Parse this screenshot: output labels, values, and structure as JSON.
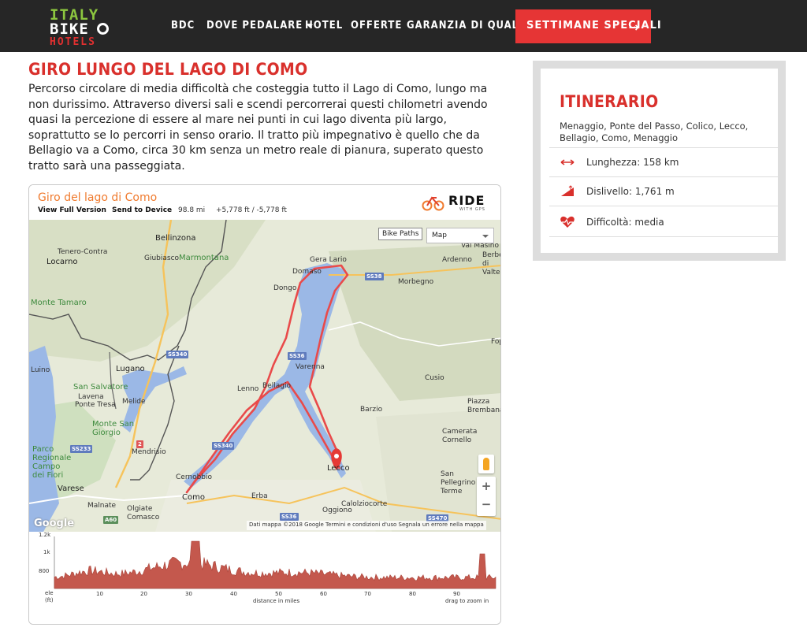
{
  "brand": {
    "line1": "ITALY",
    "line2": "BIKE",
    "line3": "HOTELS"
  },
  "nav": {
    "items": [
      "BDC",
      "DOVE PEDALARE",
      "HOTEL",
      "OFFERTE",
      "GARANZIA DI QUALITÀ"
    ],
    "cta": "SETTIMANE SPECIALI",
    "cta_arrow": "→"
  },
  "article": {
    "title": "GIRO LUNGO DEL LAGO DI COMO",
    "description": "Percorso circolare di media difficoltà che costeggia tutto il Lago di Como, lungo ma non durissimo. Attraverso diversi sali e scendi percorrerai questi chilometri avendo quasi la percezione di essere al mare nei punti in cui lago diventa più largo, soprattutto se lo percorri in senso orario. Il tratto più impegnativo è quello che da Bellagio va a Como, circa 30 km senza un metro reale di pianura, superato questo tratto sarà una passeggiata."
  },
  "embed": {
    "route_name": "Giro del lago di Como",
    "view_full": "View Full Version",
    "send_device": "Send to Device",
    "distance": "98.8 mi",
    "elevation": "+5,778 ft / -5,778 ft",
    "logo": "RIDE",
    "logo_sub": "WITH GPS",
    "bike_paths": "Bike Paths",
    "map_type": "Map",
    "google": "Google",
    "attribution": "Dati mappa ©2018 Google    Termini e condizioni d'uso    Segnala un errore nella mappa",
    "zoom_in": "+",
    "zoom_out": "−",
    "map_labels": {
      "bellinzona": "Bellinzona",
      "tenero": "Tenero-Contra",
      "giubiasco": "Giubiasco",
      "marmontana": "Marmontana",
      "locarno": "Locarno",
      "monte_tamaro": "Monte Tamaro",
      "lugano": "Lugano",
      "san_salvatore": "San Salvatore",
      "lavena": "Lavena",
      "ponte_tresa": "Ponte Tresa",
      "melide": "Melide",
      "monte_san_giorgio": "Monte San Giorgio",
      "mendrisio": "Mendrisio",
      "parco": "Parco Regionale Campo dei Fiori",
      "varese": "Varese",
      "malnate": "Malnate",
      "olgiate": "Olgiate Comasco",
      "como": "Como",
      "cernobbio": "Cernobbio",
      "luino": "Luino",
      "gera_lario": "Gera Lario",
      "domaso": "Domaso",
      "dongo": "Dongo",
      "ardenno": "Ardenno",
      "morbegno": "Morbegno",
      "val_masino": "Val Masino",
      "berbenno": "Berbenno di Valte",
      "varenna": "Varenna",
      "bellagio": "Bellagio",
      "lenno": "Lenno",
      "cusio": "Cusio",
      "barzio": "Barzio",
      "piazza_brembana": "Piazza Brembana",
      "camerata": "Camerata Cornello",
      "san_pellegrino": "San Pellegrino Terme",
      "erba": "Erba",
      "oggiono": "Oggiono",
      "calolziocorte": "Calolziocorte",
      "lecco": "Lecco",
      "fop": "Fop",
      "ss38": "SS38",
      "ss36": "SS36",
      "ss340": "SS340",
      "ss233": "SS233",
      "ss470": "SS470",
      "a2": "2",
      "a9": "A60"
    }
  },
  "elevation_profile": {
    "y_ticks": [
      "1.2k",
      "1k",
      "800"
    ],
    "y_unit": "ele (ft)",
    "x_ticks": [
      "10",
      "20",
      "30",
      "40",
      "50",
      "60",
      "70",
      "80",
      "90"
    ],
    "x_label": "distance in miles",
    "hint": "drag to zoom in"
  },
  "sidebar": {
    "title": "ITINERARIO",
    "route": "Menaggio, Ponte del Passo, Colico, Lecco, Bellagio, Como, Menaggio",
    "length": "Lunghezza: 158 km",
    "climb": "Dislivello: 1,761 m",
    "difficulty": "Difficoltà: media"
  },
  "colors": {
    "accent": "#d9302c",
    "cta": "#e63535",
    "route": "#e94a4a",
    "lake": "#9bb8e6",
    "profile": "#c4584d"
  }
}
